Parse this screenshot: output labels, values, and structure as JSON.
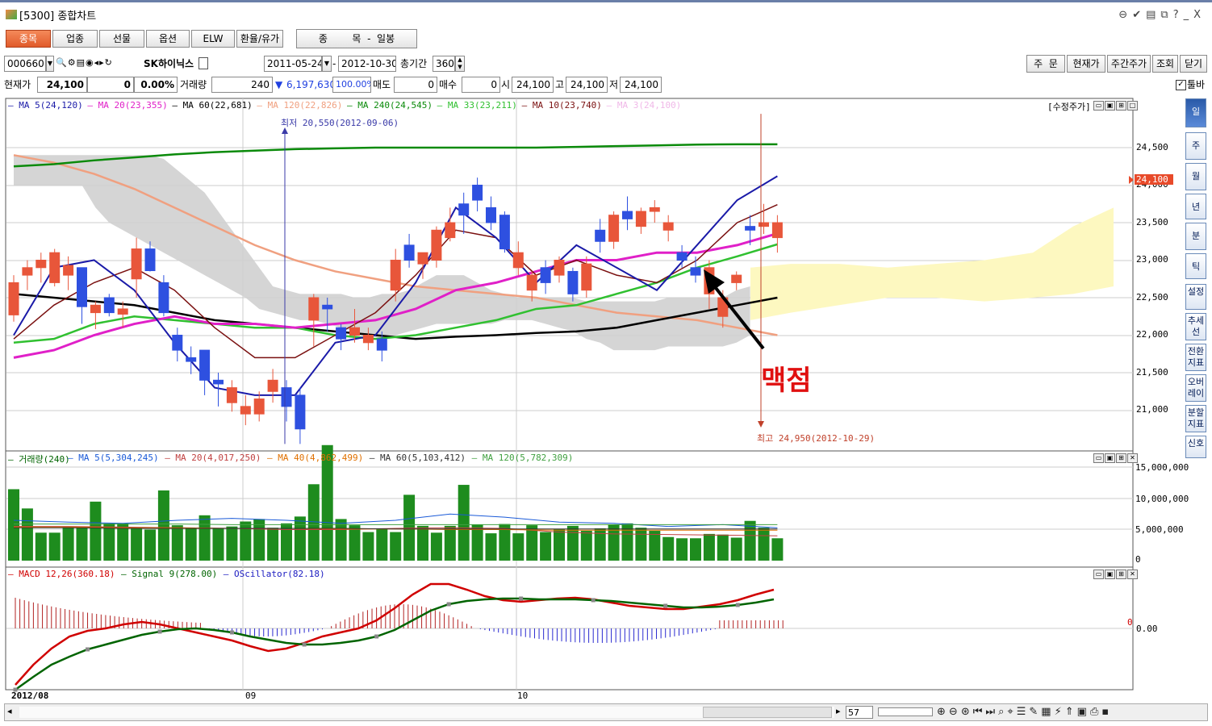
{
  "window": {
    "title": "[5300] 종합차트",
    "controls": [
      "⊖",
      "✔",
      "▤",
      "⧉",
      "?",
      "_",
      "X"
    ]
  },
  "tabs": [
    {
      "label": "종목",
      "active": true
    },
    {
      "label": "업종"
    },
    {
      "label": "선물"
    },
    {
      "label": "옵션"
    },
    {
      "label": "ELW"
    },
    {
      "label": "환율/유가"
    }
  ],
  "period_selector": "종        목  -  일봉",
  "toolbar": {
    "code": "000660",
    "name": "SK하이닉스",
    "start_date": "2011-05-24",
    "end_date": "2012-10-30",
    "total_label": "총기간",
    "total_value": "360",
    "buttons": [
      "주  문",
      "현재가",
      "주간주가",
      "조회",
      "닫기"
    ]
  },
  "quote": {
    "price_label": "현재가",
    "price": "24,100",
    "change": "0",
    "change_pct": "0.00%",
    "volume_label": "거래량",
    "volume": "240",
    "down_arrow": "▼",
    "amount": "6,197,630",
    "ratio": "100.00%",
    "sell_label": "매도",
    "sell_qty": "0",
    "buy_label": "매수",
    "buy_qty": "0",
    "open_label": "시",
    "open": "24,100",
    "high_label": "고",
    "high": "24,100",
    "low_label": "저",
    "low": "24,100",
    "toolbar_toggle": "툴바"
  },
  "price_legend": [
    {
      "text": "MA 5(24,120)",
      "color": "#1a1aa8"
    },
    {
      "text": "MA 20(23,355)",
      "color": "#e020c8"
    },
    {
      "text": "MA 60(22,681)",
      "color": "#000000"
    },
    {
      "text": "MA 120(22,826)",
      "color": "#f0a080"
    },
    {
      "text": "MA 240(24,545)",
      "color": "#0a8a0a"
    },
    {
      "text": "MA 33(23,211)",
      "color": "#30c030"
    },
    {
      "text": "MA 10(23,740)",
      "color": "#7a1010"
    },
    {
      "text": "MA 3(24,100)",
      "color": "#f0b8e8"
    }
  ],
  "adjusted_label": "[수정주가]",
  "price_axis": [
    "24,500",
    "24,000",
    "23,500",
    "23,000",
    "22,500",
    "22,000",
    "21,500",
    "21,000"
  ],
  "current_tag": "24,100",
  "annotations": {
    "low": "최저 20,550(2012-09-06)",
    "high": "최고 24,950(2012-10-29)",
    "marker": "맥점"
  },
  "volume_legend": [
    {
      "text": "거래량(240)",
      "color": "#006400"
    },
    {
      "text": "MA 5(5,304,245)",
      "color": "#1a5ad8"
    },
    {
      "text": "MA 20(4,017,250)",
      "color": "#c04040"
    },
    {
      "text": "MA 40(4,862,499)",
      "color": "#e07000"
    },
    {
      "text": "MA 60(5,103,412)",
      "color": "#303030"
    },
    {
      "text": "MA 120(5,782,309)",
      "color": "#40a040"
    }
  ],
  "volume_axis": [
    "15,000,000",
    "10,000,000",
    "5,000,000",
    "0"
  ],
  "macd_legend": [
    {
      "text": "MACD 12,26(360.18)",
      "color": "#d00000"
    },
    {
      "text": "Signal 9(278.00)",
      "color": "#006400"
    },
    {
      "text": "OScillator(82.18)",
      "color": "#1a1ac0"
    }
  ],
  "macd_axis": [
    "0",
    "0.00"
  ],
  "time_axis": [
    "2012/08",
    "09",
    "10"
  ],
  "side_buttons": [
    "일",
    "주",
    "월",
    "년",
    "분",
    "틱",
    "설정",
    "추세선",
    "전환지표",
    "오버레이",
    "분할지표",
    "신호"
  ],
  "bottom_bar": {
    "count": "57"
  },
  "colors": {
    "up": "#e8563a",
    "down": "#2e50e0",
    "volume": "#1e8c1e",
    "cloud_gray": "#d0d0d0",
    "cloud_yellow": "#fdf8c0"
  }
}
